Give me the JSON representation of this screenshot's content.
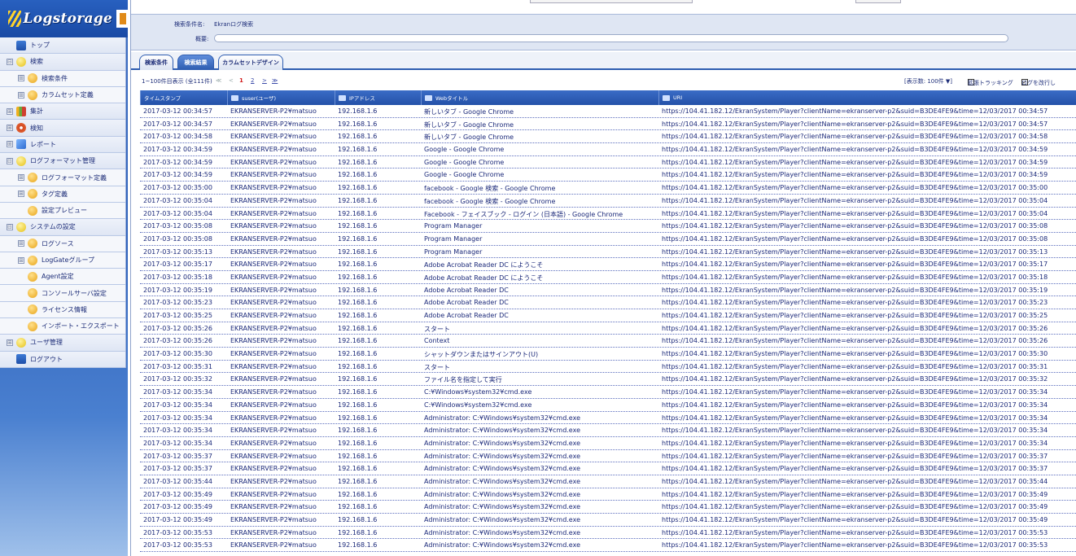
{
  "app": {
    "logo_text": "Logstorage"
  },
  "sidebar": {
    "items": [
      {
        "label": "トップ",
        "expander": "",
        "icon": "top-icon",
        "level": 0
      },
      {
        "label": "検索",
        "expander": "⊟",
        "icon": "search-icon",
        "level": 0
      },
      {
        "label": "検索条件",
        "expander": "⊞",
        "icon": "condition-icon",
        "level": 1
      },
      {
        "label": "カラムセット定義",
        "expander": "⊞",
        "icon": "columnset-icon",
        "level": 1
      },
      {
        "label": "集計",
        "expander": "⊞",
        "icon": "chart-icon",
        "level": 0
      },
      {
        "label": "検知",
        "expander": "⊞",
        "icon": "detect-icon",
        "level": 0
      },
      {
        "label": "レポート",
        "expander": "⊞",
        "icon": "report-icon",
        "level": 0
      },
      {
        "label": "ログフォーマット管理",
        "expander": "⊟",
        "icon": "format-icon",
        "level": 0
      },
      {
        "label": "ログフォーマット定義",
        "expander": "⊞",
        "icon": "format-def-icon",
        "level": 1
      },
      {
        "label": "タグ定義",
        "expander": "⊞",
        "icon": "tag-icon",
        "level": 1
      },
      {
        "label": "設定プレビュー",
        "expander": "",
        "icon": "preview-icon",
        "level": 1
      },
      {
        "label": "システムの設定",
        "expander": "⊟",
        "icon": "system-icon",
        "level": 0
      },
      {
        "label": "ログソース",
        "expander": "⊞",
        "icon": "logsource-icon",
        "level": 1
      },
      {
        "label": "LogGateグループ",
        "expander": "⊞",
        "icon": "loggate-icon",
        "level": 1
      },
      {
        "label": "Agent設定",
        "expander": "",
        "icon": "agent-icon",
        "level": 1
      },
      {
        "label": "コンソールサーバ設定",
        "expander": "",
        "icon": "console-icon",
        "level": 1
      },
      {
        "label": "ライセンス情報",
        "expander": "",
        "icon": "license-icon",
        "level": 1
      },
      {
        "label": "インポート・エクスポート",
        "expander": "",
        "icon": "import-export-icon",
        "level": 1
      },
      {
        "label": "ユーザ管理",
        "expander": "⊞",
        "icon": "user-icon",
        "level": 0
      },
      {
        "label": "ログアウト",
        "expander": "",
        "icon": "logout-icon",
        "level": 0
      }
    ]
  },
  "condition": {
    "name_label": "検索条件名:",
    "name_value": "Ekranログ検索",
    "summary_label": "概要:"
  },
  "tabs": [
    {
      "label": "検索条件",
      "active": false
    },
    {
      "label": "検索結果",
      "active": true
    },
    {
      "label": "カラムセットデザイン",
      "active": false
    }
  ],
  "pager": {
    "range": "1~100件目表示 (全111件)",
    "first": "≪",
    "prev": "<",
    "current": "1",
    "page2": "2",
    "next": ">",
    "last": "≫",
    "page_size": "[表示数: 100件 ▼]",
    "extended_tracking": "拡張トラッキング",
    "wrap_log": "ログを改行し"
  },
  "grid": {
    "columns": [
      "タイムスタンプ",
      "suser(ユーザ)",
      "IPアドレス",
      "Webタイトル",
      "URI"
    ],
    "rows": [
      [
        "2017-03-12 00:34:57",
        "EKRANSERVER-P2¥matsuo",
        "192.168.1.6",
        "新しいタブ - Google Chrome",
        "https://104.41.182.12/EkranSystem/Player?clientName=ekranserver-p2&suid=B3DE4FE9&time=12/03/2017 00:34:57"
      ],
      [
        "2017-03-12 00:34:57",
        "EKRANSERVER-P2¥matsuo",
        "192.168.1.6",
        "新しいタブ - Google Chrome",
        "https://104.41.182.12/EkranSystem/Player?clientName=ekranserver-p2&suid=B3DE4FE9&time=12/03/2017 00:34:57"
      ],
      [
        "2017-03-12 00:34:58",
        "EKRANSERVER-P2¥matsuo",
        "192.168.1.6",
        "新しいタブ - Google Chrome",
        "https://104.41.182.12/EkranSystem/Player?clientName=ekranserver-p2&suid=B3DE4FE9&time=12/03/2017 00:34:58"
      ],
      [
        "2017-03-12 00:34:59",
        "EKRANSERVER-P2¥matsuo",
        "192.168.1.6",
        "Google - Google Chrome",
        "https://104.41.182.12/EkranSystem/Player?clientName=ekranserver-p2&suid=B3DE4FE9&time=12/03/2017 00:34:59"
      ],
      [
        "2017-03-12 00:34:59",
        "EKRANSERVER-P2¥matsuo",
        "192.168.1.6",
        "Google - Google Chrome",
        "https://104.41.182.12/EkranSystem/Player?clientName=ekranserver-p2&suid=B3DE4FE9&time=12/03/2017 00:34:59"
      ],
      [
        "2017-03-12 00:34:59",
        "EKRANSERVER-P2¥matsuo",
        "192.168.1.6",
        "Google - Google Chrome",
        "https://104.41.182.12/EkranSystem/Player?clientName=ekranserver-p2&suid=B3DE4FE9&time=12/03/2017 00:34:59"
      ],
      [
        "2017-03-12 00:35:00",
        "EKRANSERVER-P2¥matsuo",
        "192.168.1.6",
        "facebook - Google 検索 - Google Chrome",
        "https://104.41.182.12/EkranSystem/Player?clientName=ekranserver-p2&suid=B3DE4FE9&time=12/03/2017 00:35:00"
      ],
      [
        "2017-03-12 00:35:04",
        "EKRANSERVER-P2¥matsuo",
        "192.168.1.6",
        "facebook - Google 検索 - Google Chrome",
        "https://104.41.182.12/EkranSystem/Player?clientName=ekranserver-p2&suid=B3DE4FE9&time=12/03/2017 00:35:04"
      ],
      [
        "2017-03-12 00:35:04",
        "EKRANSERVER-P2¥matsuo",
        "192.168.1.6",
        "Facebook - フェイスブック - ログイン (日本語) - Google Chrome",
        "https://104.41.182.12/EkranSystem/Player?clientName=ekranserver-p2&suid=B3DE4FE9&time=12/03/2017 00:35:04"
      ],
      [
        "2017-03-12 00:35:08",
        "EKRANSERVER-P2¥matsuo",
        "192.168.1.6",
        "Program Manager",
        "https://104.41.182.12/EkranSystem/Player?clientName=ekranserver-p2&suid=B3DE4FE9&time=12/03/2017 00:35:08"
      ],
      [
        "2017-03-12 00:35:08",
        "EKRANSERVER-P2¥matsuo",
        "192.168.1.6",
        "Program Manager",
        "https://104.41.182.12/EkranSystem/Player?clientName=ekranserver-p2&suid=B3DE4FE9&time=12/03/2017 00:35:08"
      ],
      [
        "2017-03-12 00:35:13",
        "EKRANSERVER-P2¥matsuo",
        "192.168.1.6",
        "Program Manager",
        "https://104.41.182.12/EkranSystem/Player?clientName=ekranserver-p2&suid=B3DE4FE9&time=12/03/2017 00:35:13"
      ],
      [
        "2017-03-12 00:35:17",
        "EKRANSERVER-P2¥matsuo",
        "192.168.1.6",
        "Adobe Acrobat Reader DC にようこそ",
        "https://104.41.182.12/EkranSystem/Player?clientName=ekranserver-p2&suid=B3DE4FE9&time=12/03/2017 00:35:17"
      ],
      [
        "2017-03-12 00:35:18",
        "EKRANSERVER-P2¥matsuo",
        "192.168.1.6",
        "Adobe Acrobat Reader DC にようこそ",
        "https://104.41.182.12/EkranSystem/Player?clientName=ekranserver-p2&suid=B3DE4FE9&time=12/03/2017 00:35:18"
      ],
      [
        "2017-03-12 00:35:19",
        "EKRANSERVER-P2¥matsuo",
        "192.168.1.6",
        "Adobe Acrobat Reader DC",
        "https://104.41.182.12/EkranSystem/Player?clientName=ekranserver-p2&suid=B3DE4FE9&time=12/03/2017 00:35:19"
      ],
      [
        "2017-03-12 00:35:23",
        "EKRANSERVER-P2¥matsuo",
        "192.168.1.6",
        "Adobe Acrobat Reader DC",
        "https://104.41.182.12/EkranSystem/Player?clientName=ekranserver-p2&suid=B3DE4FE9&time=12/03/2017 00:35:23"
      ],
      [
        "2017-03-12 00:35:25",
        "EKRANSERVER-P2¥matsuo",
        "192.168.1.6",
        "Adobe Acrobat Reader DC",
        "https://104.41.182.12/EkranSystem/Player?clientName=ekranserver-p2&suid=B3DE4FE9&time=12/03/2017 00:35:25"
      ],
      [
        "2017-03-12 00:35:26",
        "EKRANSERVER-P2¥matsuo",
        "192.168.1.6",
        "スタート",
        "https://104.41.182.12/EkranSystem/Player?clientName=ekranserver-p2&suid=B3DE4FE9&time=12/03/2017 00:35:26"
      ],
      [
        "2017-03-12 00:35:26",
        "EKRANSERVER-P2¥matsuo",
        "192.168.1.6",
        "Context",
        "https://104.41.182.12/EkranSystem/Player?clientName=ekranserver-p2&suid=B3DE4FE9&time=12/03/2017 00:35:26"
      ],
      [
        "2017-03-12 00:35:30",
        "EKRANSERVER-P2¥matsuo",
        "192.168.1.6",
        "シャットダウンまたはサインアウト(U)",
        "https://104.41.182.12/EkranSystem/Player?clientName=ekranserver-p2&suid=B3DE4FE9&time=12/03/2017 00:35:30"
      ],
      [
        "2017-03-12 00:35:31",
        "EKRANSERVER-P2¥matsuo",
        "192.168.1.6",
        "スタート",
        "https://104.41.182.12/EkranSystem/Player?clientName=ekranserver-p2&suid=B3DE4FE9&time=12/03/2017 00:35:31"
      ],
      [
        "2017-03-12 00:35:32",
        "EKRANSERVER-P2¥matsuo",
        "192.168.1.6",
        "ファイル名を指定して実行",
        "https://104.41.182.12/EkranSystem/Player?clientName=ekranserver-p2&suid=B3DE4FE9&time=12/03/2017 00:35:32"
      ],
      [
        "2017-03-12 00:35:34",
        "EKRANSERVER-P2¥matsuo",
        "192.168.1.6",
        "C:¥Windows¥system32¥cmd.exe",
        "https://104.41.182.12/EkranSystem/Player?clientName=ekranserver-p2&suid=B3DE4FE9&time=12/03/2017 00:35:34"
      ],
      [
        "2017-03-12 00:35:34",
        "EKRANSERVER-P2¥matsuo",
        "192.168.1.6",
        "C:¥Windows¥system32¥cmd.exe",
        "https://104.41.182.12/EkranSystem/Player?clientName=ekranserver-p2&suid=B3DE4FE9&time=12/03/2017 00:35:34"
      ],
      [
        "2017-03-12 00:35:34",
        "EKRANSERVER-P2¥matsuo",
        "192.168.1.6",
        "Administrator: C:¥Windows¥system32¥cmd.exe",
        "https://104.41.182.12/EkranSystem/Player?clientName=ekranserver-p2&suid=B3DE4FE9&time=12/03/2017 00:35:34"
      ],
      [
        "2017-03-12 00:35:34",
        "EKRANSERVER-P2¥matsuo",
        "192.168.1.6",
        "Administrator: C:¥Windows¥system32¥cmd.exe",
        "https://104.41.182.12/EkranSystem/Player?clientName=ekranserver-p2&suid=B3DE4FE9&time=12/03/2017 00:35:34"
      ],
      [
        "2017-03-12 00:35:34",
        "EKRANSERVER-P2¥matsuo",
        "192.168.1.6",
        "Administrator: C:¥Windows¥system32¥cmd.exe",
        "https://104.41.182.12/EkranSystem/Player?clientName=ekranserver-p2&suid=B3DE4FE9&time=12/03/2017 00:35:34"
      ],
      [
        "2017-03-12 00:35:37",
        "EKRANSERVER-P2¥matsuo",
        "192.168.1.6",
        "Administrator: C:¥Windows¥system32¥cmd.exe",
        "https://104.41.182.12/EkranSystem/Player?clientName=ekranserver-p2&suid=B3DE4FE9&time=12/03/2017 00:35:37"
      ],
      [
        "2017-03-12 00:35:37",
        "EKRANSERVER-P2¥matsuo",
        "192.168.1.6",
        "Administrator: C:¥Windows¥system32¥cmd.exe",
        "https://104.41.182.12/EkranSystem/Player?clientName=ekranserver-p2&suid=B3DE4FE9&time=12/03/2017 00:35:37"
      ],
      [
        "2017-03-12 00:35:44",
        "EKRANSERVER-P2¥matsuo",
        "192.168.1.6",
        "Administrator: C:¥Windows¥system32¥cmd.exe",
        "https://104.41.182.12/EkranSystem/Player?clientName=ekranserver-p2&suid=B3DE4FE9&time=12/03/2017 00:35:44"
      ],
      [
        "2017-03-12 00:35:49",
        "EKRANSERVER-P2¥matsuo",
        "192.168.1.6",
        "Administrator: C:¥Windows¥system32¥cmd.exe",
        "https://104.41.182.12/EkranSystem/Player?clientName=ekranserver-p2&suid=B3DE4FE9&time=12/03/2017 00:35:49"
      ],
      [
        "2017-03-12 00:35:49",
        "EKRANSERVER-P2¥matsuo",
        "192.168.1.6",
        "Administrator: C:¥Windows¥system32¥cmd.exe",
        "https://104.41.182.12/EkranSystem/Player?clientName=ekranserver-p2&suid=B3DE4FE9&time=12/03/2017 00:35:49"
      ],
      [
        "2017-03-12 00:35:49",
        "EKRANSERVER-P2¥matsuo",
        "192.168.1.6",
        "Administrator: C:¥Windows¥system32¥cmd.exe",
        "https://104.41.182.12/EkranSystem/Player?clientName=ekranserver-p2&suid=B3DE4FE9&time=12/03/2017 00:35:49"
      ],
      [
        "2017-03-12 00:35:53",
        "EKRANSERVER-P2¥matsuo",
        "192.168.1.6",
        "Administrator: C:¥Windows¥system32¥cmd.exe",
        "https://104.41.182.12/EkranSystem/Player?clientName=ekranserver-p2&suid=B3DE4FE9&time=12/03/2017 00:35:53"
      ],
      [
        "2017-03-12 00:35:53",
        "EKRANSERVER-P2¥matsuo",
        "192.168.1.6",
        "Administrator: C:¥Windows¥system32¥cmd.exe",
        "https://104.41.182.12/EkranSystem/Player?clientName=ekranserver-p2&suid=B3DE4FE9&time=12/03/2017 00:35:53"
      ]
    ]
  }
}
